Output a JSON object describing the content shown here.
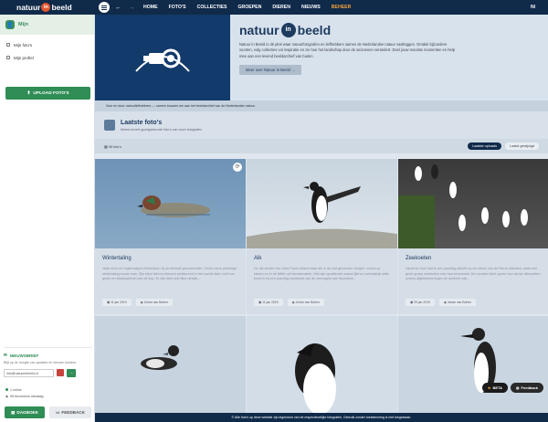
{
  "topbar": {
    "logo_word1": "natuur",
    "logo_in": "in",
    "logo_word2": "beeld",
    "nav": [
      "HOME",
      "FOTO'S",
      "COLLECTIES",
      "GROEPEN",
      "DIEREN",
      "NIEUWS",
      "BEHEER"
    ],
    "user_initials": "NI"
  },
  "sidebar": {
    "section_title": "Mijn",
    "items": [
      "Mijn foto's",
      "Mijn profiel"
    ],
    "upload_label": "UPLOAD FOTO'S",
    "newsletter": {
      "title": "NIEUWSBRIEF",
      "text": "Blijf op de hoogte van updates en nieuwe functies.",
      "email": "info@natuurinbeeld.nl"
    },
    "status": [
      "1 online",
      "98 bezoekers vandaag"
    ],
    "dagboek_label": "DAGBOEK",
    "feedback_label": "FEEDBACK"
  },
  "hero": {
    "logo_word1": "natuur",
    "logo_in": "in",
    "logo_word2": "beeld",
    "text": "Natuur in Beeld is dé plek waar natuurfotografen en liefhebbers samen de Nederlandse natuur vastleggen. Ontdek bijzondere soorten, volg collecties vol inspiratie en zie hoe het landschap door de seizoenen verandert. Deel jouw mooiste momenten en help mee aan een levend beeldarchief van buiten.",
    "button": "Meer over Natuur in Beeld →"
  },
  "strip": "Voor en door natuurliefhebbers — samen bouwen we aan het beeldarchief van de Nederlandse natuur.",
  "latest": {
    "title": "Laatste foto's",
    "subtitle": "Meest recent goedgekeurde foto's van onze fotografen"
  },
  "filter": {
    "label": "98 foto's",
    "sort_active": "Laatste uploads",
    "sort_other": "Laatst gewijzigd"
  },
  "cards": [
    {
      "title": "Wintertaling",
      "desc": "Vaak mooi en regelmatig in Nederland, hij de kleinste grondeenden. Zeven deze prachtige wintertaling mooie man. Zijn kleur licht en kleuren schitterend in het zachte licht, met hun groen en kastanjebruin van de kop. Er zijn heel veel fijne details...",
      "date": "11 jan 2019",
      "author": "Johan van Bohen"
    },
    {
      "title": "Alk",
      "desc": "De alk vinden hier deze Farne-eiland waar alk in de rust gevonden vliegen, vooral op kiezen en in de kliffen wil kennismaken. Met zijn opvallende snavel lijkt en contrastrijk witte borst is hij een prachtig voorbeeld van de zeevogels van Noordzee...",
      "date": "11 jan 2019",
      "author": "Johan van Bohen"
    },
    {
      "title": "Zeekoeten",
      "desc": "Vanaf de boot had ik een prachtig uitzicht op de rotsen van de Farne-eilanden, waar een grote groep zeekoeten zich had verzameld. De mooiste dicht opeen hun sterke silhouetten scherp afgetekend tegen de donkere rots...",
      "date": "09 jan 2019",
      "author": "Johan van Bohen"
    }
  ],
  "beta_label": "BETA",
  "feedback_pill": "Feedback",
  "footer": "© Alle foto's op deze website zijn eigendom van de respectievelijke fotografen. Gebruik zonder toestemming is niet toegestaan."
}
